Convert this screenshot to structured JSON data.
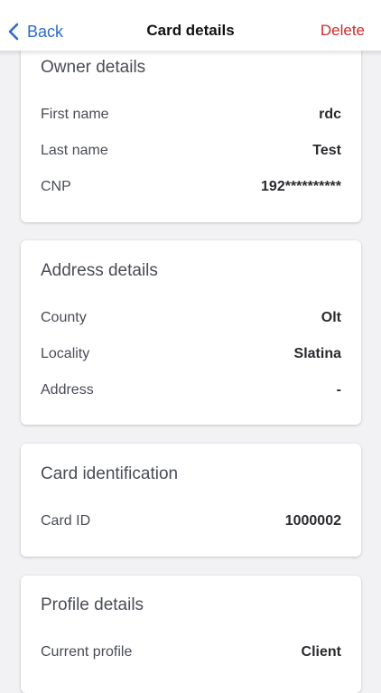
{
  "nav": {
    "back_label": "Back",
    "title": "Card details",
    "delete_label": "Delete"
  },
  "colors": {
    "accent": "#2d6cc6",
    "danger": "#cf2a2a",
    "background": "#f2f2f4",
    "card": "#ffffff"
  },
  "icons": {
    "back": "chevron-left-icon"
  },
  "sections": {
    "owner": {
      "title": "Owner details",
      "rows": [
        {
          "label": "First name",
          "value": "rdc"
        },
        {
          "label": "Last name",
          "value": "Test"
        },
        {
          "label": "CNP",
          "value": "192**********"
        }
      ]
    },
    "address": {
      "title": "Address details",
      "rows": [
        {
          "label": "County",
          "value": "Olt"
        },
        {
          "label": "Locality",
          "value": "Slatina"
        },
        {
          "label": "Address",
          "value": "-"
        }
      ]
    },
    "identification": {
      "title": "Card identification",
      "rows": [
        {
          "label": "Card ID",
          "value": "1000002"
        }
      ]
    },
    "profile": {
      "title": "Profile details",
      "rows": [
        {
          "label": "Current profile",
          "value": "Client"
        }
      ]
    }
  }
}
